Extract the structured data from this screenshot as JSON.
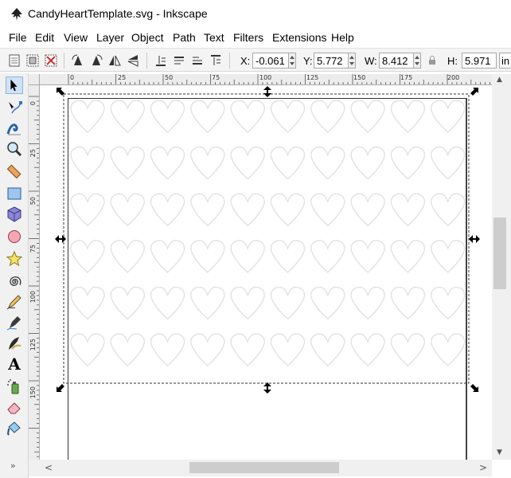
{
  "window": {
    "title": "CandyHeartTemplate.svg - Inkscape"
  },
  "menubar": {
    "items": [
      "File",
      "Edit",
      "View",
      "Layer",
      "Object",
      "Path",
      "Text",
      "Filters",
      "Extensions",
      "Help"
    ]
  },
  "toolbar": {
    "x_label": "X:",
    "x_value": "-0.061",
    "y_label": "Y:",
    "y_value": "5.772",
    "w_label": "W:",
    "w_value": "8.412",
    "h_label": "H:",
    "h_value": "5.971",
    "unit_value": "in",
    "icons": [
      "select-all-icon",
      "select-all-layers-icon",
      "deselect-icon",
      "rotate-ccw-icon",
      "rotate-cw-icon",
      "flip-horizontal-icon",
      "flip-vertical-icon",
      "lower-bottom-icon",
      "lower-icon",
      "raise-icon",
      "raise-top-icon",
      "lock-ratio-icon"
    ]
  },
  "ruler": {
    "h_ticks": [
      "0",
      "25",
      "50",
      "75",
      "100",
      "125",
      "150",
      "175",
      "200"
    ],
    "v_ticks": [
      "0",
      "25",
      "50",
      "75",
      "100",
      "125",
      "150"
    ]
  },
  "toolbox": {
    "tools": [
      "selector-tool-icon",
      "node-tool-icon",
      "tweak-tool-icon",
      "zoom-tool-icon",
      "measure-tool-icon",
      "rectangle-tool-icon",
      "3d-box-tool-icon",
      "ellipse-tool-icon",
      "star-tool-icon",
      "spiral-tool-icon",
      "pencil-tool-icon",
      "pen-tool-icon",
      "calligraphy-tool-icon",
      "text-tool-icon",
      "spray-tool-icon",
      "eraser-tool-icon",
      "paint-bucket-tool-icon"
    ],
    "text_tool_glyph": "A",
    "expand_glyph": "»"
  },
  "canvas": {
    "heart_rows": 6,
    "heart_cols": 10
  },
  "scrollbars": {
    "up": "▲",
    "down": "▼",
    "left": "<",
    "right": ">"
  }
}
